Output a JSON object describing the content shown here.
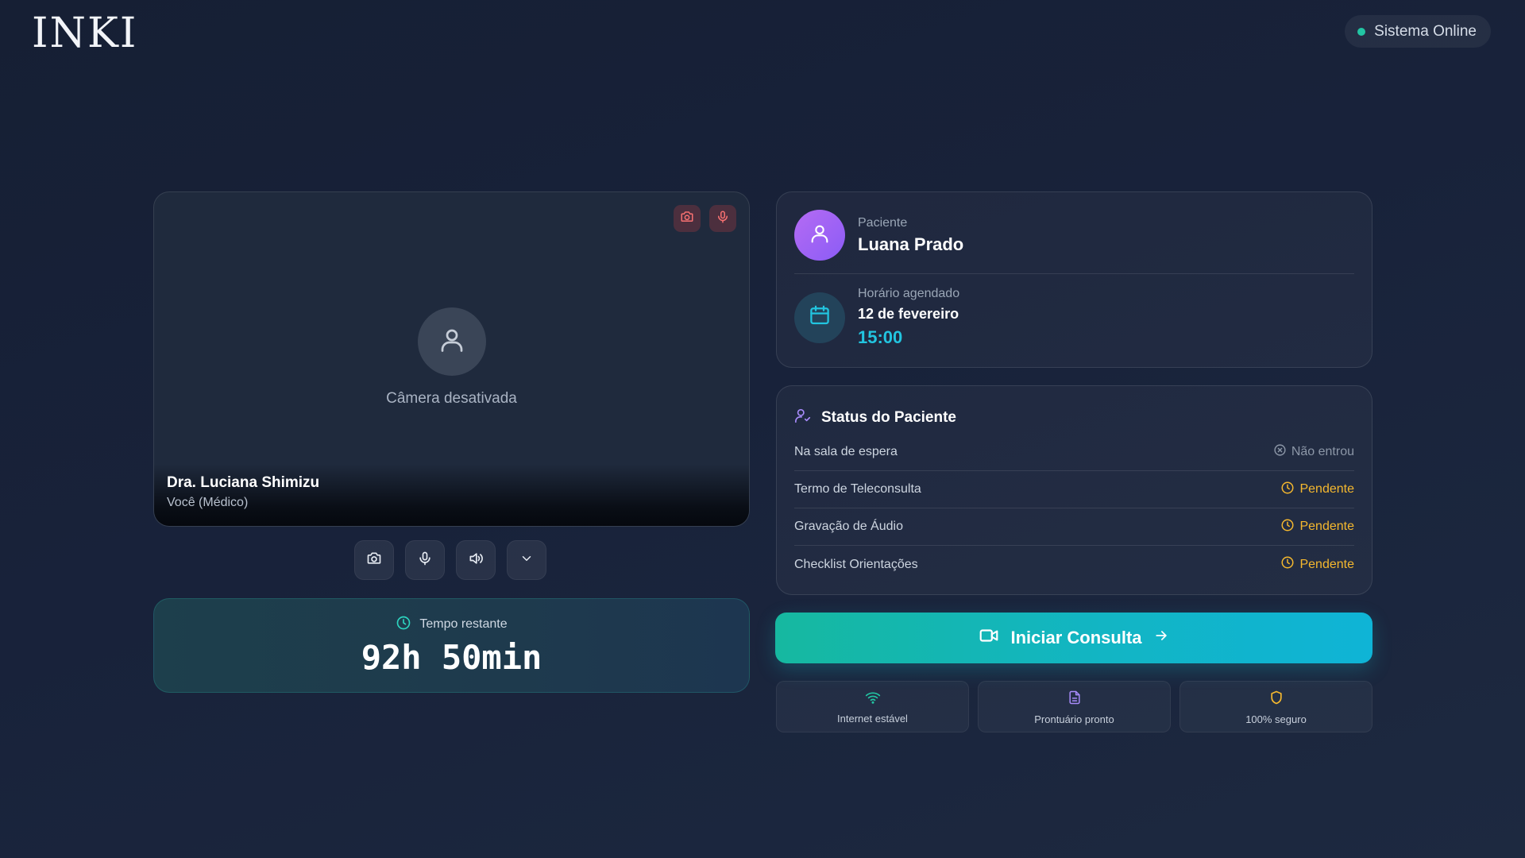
{
  "brand": {
    "logo_text": "INKI"
  },
  "system_status": {
    "label": "Sistema Online",
    "color": "#22c5a3"
  },
  "video": {
    "camera_off_text": "Câmera desativada",
    "doctor_name": "Dra. Luciana Shimizu",
    "doctor_role": "Você (Médico)",
    "corner_icons": [
      "camera-off-icon",
      "mic-off-icon"
    ]
  },
  "controls": [
    "camera-icon",
    "microphone-icon",
    "speaker-icon",
    "chevron-down-icon"
  ],
  "timer": {
    "label": "Tempo restante",
    "value": "92h 50min"
  },
  "patient": {
    "label": "Paciente",
    "name": "Luana Prado",
    "schedule_label": "Horário agendado",
    "date": "12 de fevereiro",
    "time": "15:00"
  },
  "patient_status": {
    "title": "Status do Paciente",
    "rows": [
      {
        "label": "Na sala de espera",
        "value": "Não entrou",
        "state": "muted"
      },
      {
        "label": "Termo de Teleconsulta",
        "value": "Pendente",
        "state": "pending"
      },
      {
        "label": "Gravação de Áudio",
        "value": "Pendente",
        "state": "pending"
      },
      {
        "label": "Checklist Orientações",
        "value": "Pendente",
        "state": "pending"
      }
    ]
  },
  "start_button": {
    "label": "Iniciar Consulta"
  },
  "indicators": [
    {
      "label": "Internet estável",
      "icon": "wifi-icon",
      "color": "#22c5a3"
    },
    {
      "label": "Prontuário pronto",
      "icon": "document-icon",
      "color": "#a78bfa"
    },
    {
      "label": "100% seguro",
      "icon": "shield-icon",
      "color": "#f5b82e"
    }
  ],
  "colors": {
    "accent_teal": "#14b8a6",
    "accent_cyan": "#22c5e0",
    "pending": "#f5b82e",
    "danger": "#ef4444"
  }
}
